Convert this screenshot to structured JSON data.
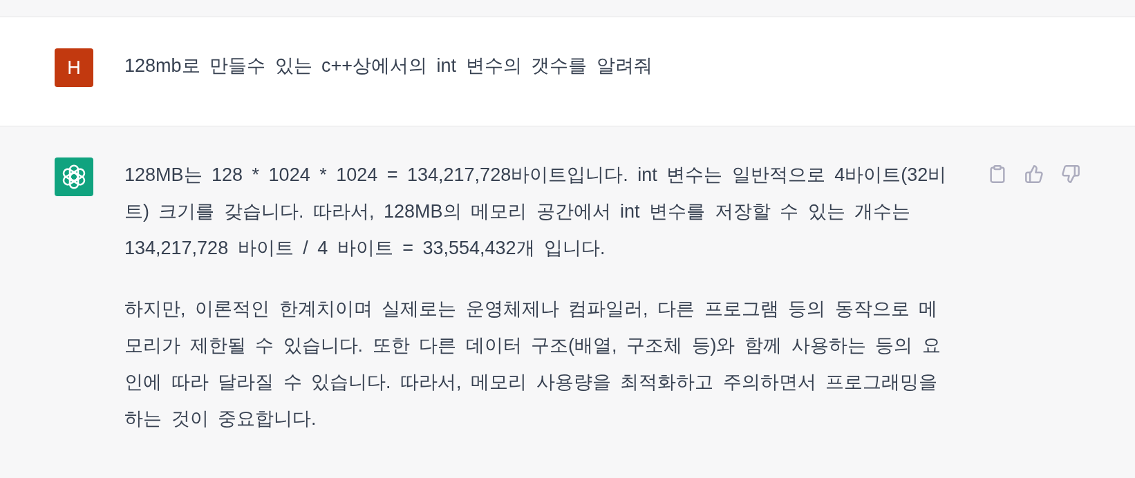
{
  "messages": [
    {
      "kind": "user",
      "avatar": {
        "letter": "H",
        "color": "#c2390f"
      },
      "paragraphs": [
        {
          "lines": [
            "128mb로 만들수 있는 c++상에서의 int 변수의 갯수를 알려줘"
          ]
        }
      ]
    },
    {
      "kind": "assistant",
      "avatar": {
        "color": "#10a37f"
      },
      "paragraphs": [
        {
          "lines": [
            "128MB는 128 * 1024 * 1024 = 134,217,728바이트입니다. int 변수는 일반적으로 4바이트(32비",
            "트) 크기를 갖습니다. 따라서, 128MB의 메모리 공간에서 int 변수를 저장할 수 있는 개수는",
            "134,217,728 바이트 / 4 바이트 = 33,554,432개 입니다."
          ]
        },
        {
          "lines": [
            "하지만, 이론적인 한계치이며 실제로는 운영체제나 컴파일러, 다른 프로그램 등의 동작으로 메",
            "모리가 제한될 수 있습니다. 또한 다른 데이터 구조(배열, 구조체 등)와 함께 사용하는 등의 요",
            "인에 따라 달라질 수 있습니다. 따라서, 메모리 사용량을 최적화하고 주의하면서 프로그래밍을",
            "하는 것이 중요합니다."
          ]
        }
      ]
    }
  ]
}
